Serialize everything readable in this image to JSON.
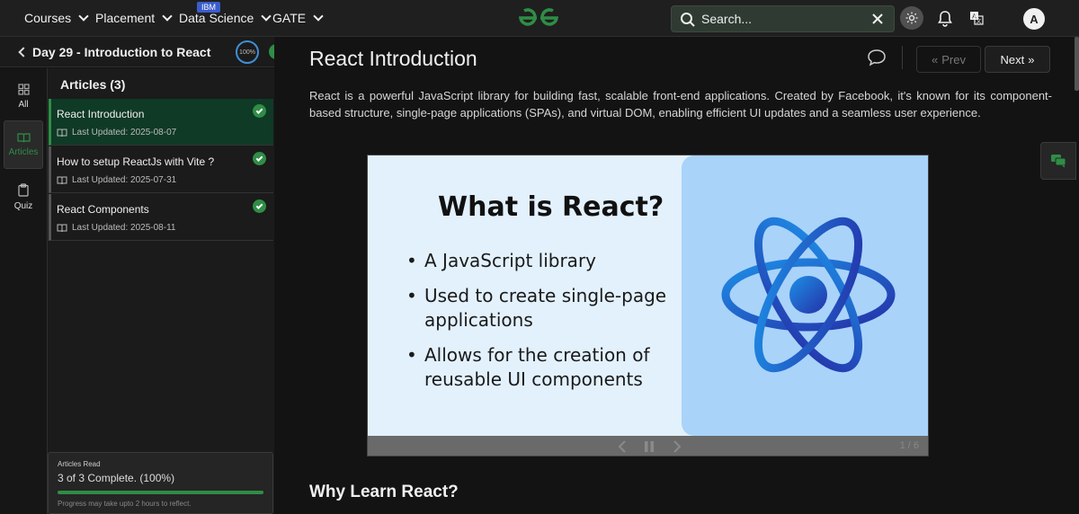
{
  "nav": {
    "items": [
      {
        "label": "Courses"
      },
      {
        "label": "Placement"
      },
      {
        "label": "Data Science"
      },
      {
        "label": "GATE"
      }
    ],
    "ibm_badge": "IBM",
    "logo_icon": "gfg-logo-icon",
    "search_placeholder": "Search...",
    "avatar_letter": "A",
    "colors": {
      "brand": "#2f8d46",
      "topbar": "#1f1f1f"
    }
  },
  "sidebar": {
    "day_title": "Day 29 - Introduction to React",
    "progress_ring_label": "100%",
    "rail": [
      {
        "label": "All",
        "icon": "grid-icon"
      },
      {
        "label": "Articles",
        "icon": "book-icon"
      },
      {
        "label": "Quiz",
        "icon": "clipboard-icon"
      }
    ],
    "articles_heading": "Articles (3)",
    "articles": [
      {
        "title": "React Introduction",
        "updated": "Last Updated: 2025-08-07",
        "done": true
      },
      {
        "title": "How to setup ReactJs with Vite ?",
        "updated": "Last Updated: 2025-07-31",
        "done": true
      },
      {
        "title": "React Components",
        "updated": "Last Updated: 2025-08-11",
        "done": true
      }
    ],
    "read": {
      "label": "Articles Read",
      "count_text": "3 of 3 Complete. (100%)",
      "progress_fraction": 1.0,
      "note": "Progress may take upto 2 hours to reflect."
    }
  },
  "main": {
    "title": "React Introduction",
    "prev_label": "Prev",
    "next_label": "Next",
    "intro": "React is a powerful JavaScript library for building fast, scalable front-end applications. Created by Facebook, it's known for its component-based structure, single-page applications (SPAs), and virtual DOM, enabling efficient UI updates and a seamless user experience.",
    "slide": {
      "title": "What is React?",
      "bullets": [
        "A JavaScript library",
        "Used to create single-page applications",
        "Allows for the creation of reusable UI components"
      ],
      "page": "1 / 6"
    },
    "section_title": "Why Learn React?"
  }
}
